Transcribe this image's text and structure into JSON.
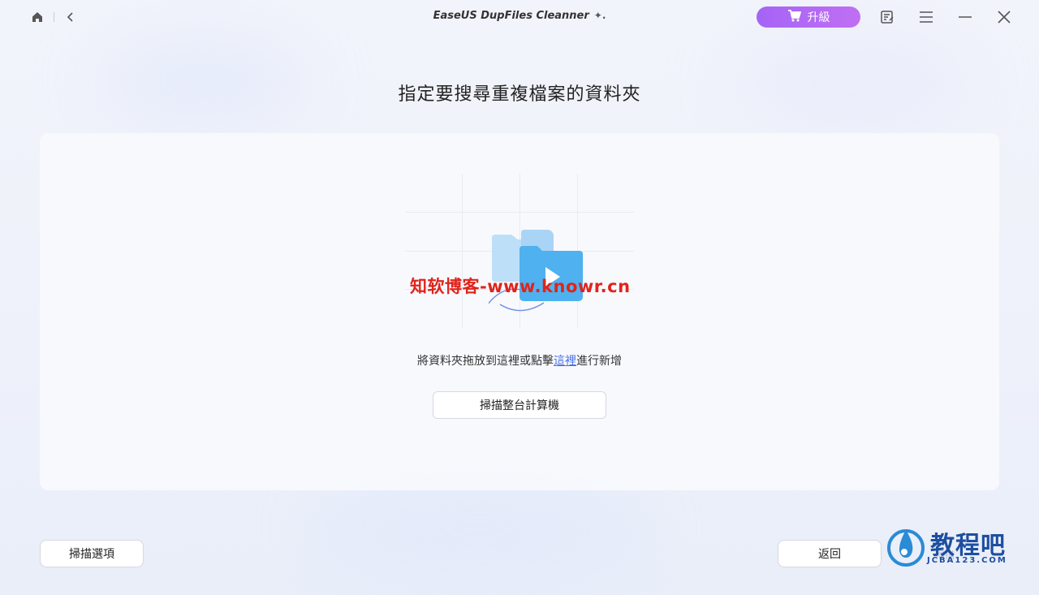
{
  "window": {
    "title": "EaseUS DupFiles Cleanner",
    "title_sparkle": "✦.",
    "upgrade_label": "升級"
  },
  "page": {
    "heading": "指定要搜尋重複檔案的資料夾",
    "drop_prefix": "將資料夾拖放到這裡或點擊",
    "drop_link": "這裡",
    "drop_suffix": "進行新增",
    "scan_pc_label": "掃描整台計算機"
  },
  "footer": {
    "scan_options_label": "掃描選項",
    "back_label": "返回",
    "hidden_label": "掃描"
  },
  "overlays": {
    "watermark_text": "知软博客-www.knowr.cn",
    "logo_text": "教程吧",
    "logo_sub": "JCBA123.COM"
  },
  "colors": {
    "accent": "#a564f6",
    "link": "#4a72e8",
    "watermark": "#e0241b"
  }
}
